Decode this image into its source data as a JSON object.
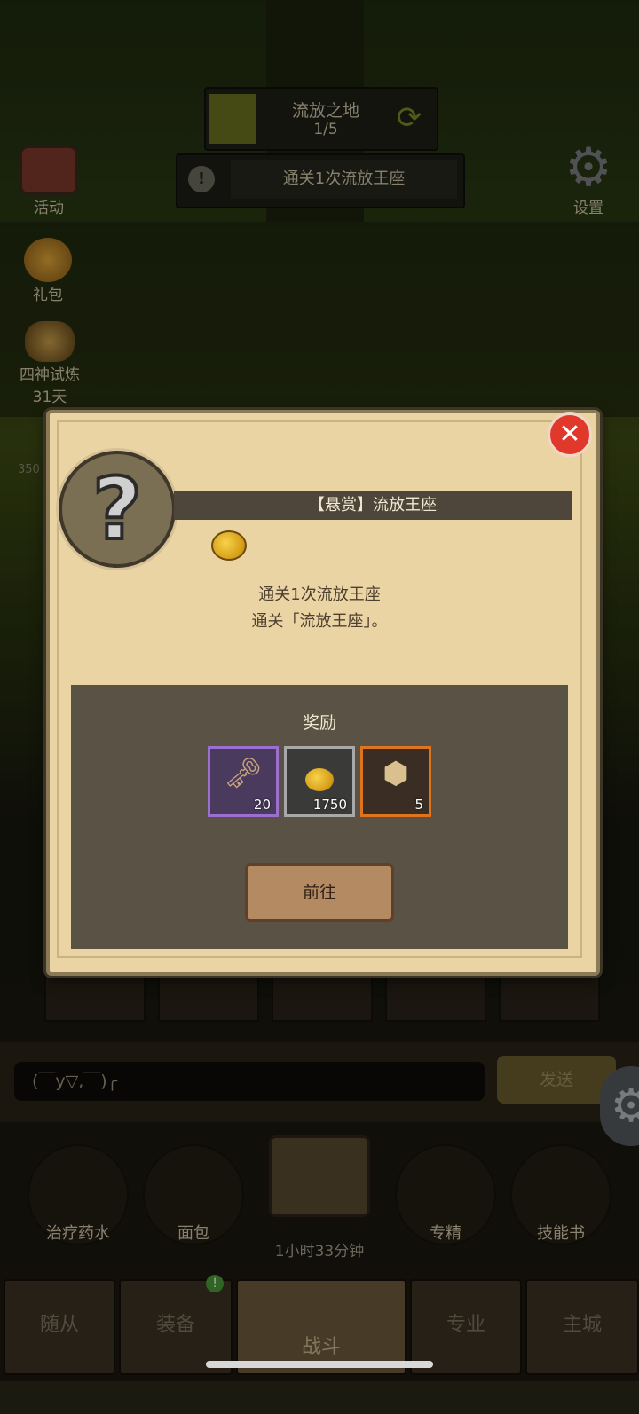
{
  "top": {
    "stage_name": "流放之地",
    "stage_count": "1/5",
    "quest_text": "通关1次流放王座"
  },
  "side": {
    "events_label": "活动",
    "gift_label": "礼包",
    "trial_label": "四神试炼",
    "trial_days": "31天",
    "settings_label": "设置",
    "level_tag": "350"
  },
  "chat": {
    "input_text": "(￣y▽,￣)╭",
    "send_label": "发送"
  },
  "consumables": [
    {
      "label": "治疗药水"
    },
    {
      "label": "面包"
    },
    {
      "label": "专精"
    },
    {
      "label": "技能书"
    }
  ],
  "chest": {
    "timer": "1小时33分钟"
  },
  "nav": {
    "tabs": [
      "随从",
      "装备",
      "战斗",
      "专业",
      "主城"
    ],
    "badge": "!"
  },
  "modal": {
    "title": "【悬赏】流放王座",
    "desc_line1": "通关1次流放王座",
    "desc_line2": "通关「流放王座」。",
    "reward_title": "奖励",
    "rewards": [
      {
        "name": "key-icon",
        "count": "20",
        "border": "#9b6fd0"
      },
      {
        "name": "gold-coin-icon",
        "count": "1750",
        "border": "#a8a8a8"
      },
      {
        "name": "crate-icon",
        "count": "5",
        "border": "#e0741d"
      }
    ],
    "go_label": "前往"
  }
}
